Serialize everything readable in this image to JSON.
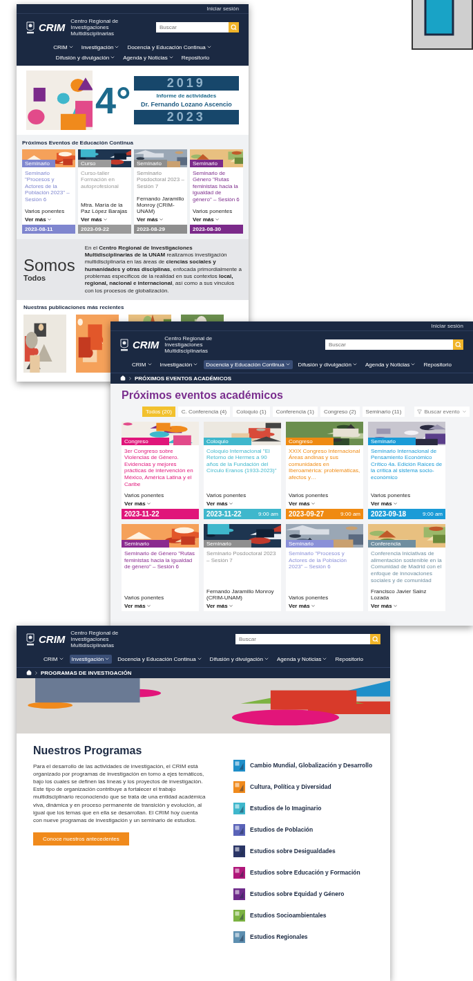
{
  "screens": [
    {
      "kind": "home",
      "header": {
        "login": "Iniciar sesión",
        "logo": "CRIM",
        "center_name": "Centro Regional de Investigaciones Multidisciplinarias",
        "search_placeholder": "Buscar",
        "nav": [
          {
            "label": "CRIM",
            "dropdown": true,
            "selected": false
          },
          {
            "label": "Investigación",
            "dropdown": true,
            "selected": false
          },
          {
            "label": "Docencia y Educación Continua",
            "dropdown": true,
            "selected": false
          },
          {
            "label": "Difusión y divulgación",
            "dropdown": true,
            "selected": false
          },
          {
            "label": "Agenda y Noticias",
            "dropdown": true,
            "selected": false
          },
          {
            "label": "Repositorio",
            "dropdown": false,
            "selected": false
          }
        ]
      },
      "hero": {
        "number": "4°",
        "year_start": "2019",
        "heading": "Informe de actividades",
        "name": "Dr. Fernando Lozano Ascencio",
        "year_end": "2023"
      },
      "events": {
        "title": "Próximos Eventos de Educación Continua",
        "cards": [
          {
            "tag": "Seminario",
            "title": "Seminario \"Procesos y Actores de la Población 2023\" – Sesión 6",
            "author": "Varios ponentes",
            "more": "Ver más",
            "date": "2023-08-11",
            "color": "#7f86cf"
          },
          {
            "tag": "Curso",
            "title": "Curso-taller Formación en autoprofesional",
            "author": "Mtra. María de la Paz López Barajas",
            "more": "Ver más",
            "date": "2023-09-22",
            "color": "#9a9a9a"
          },
          {
            "tag": "Seminario",
            "title": "Seminario Posdoctoral 2023 – Sesión 7",
            "author": "Fernando Jaramillo Monroy (CRIM-UNAM)",
            "more": "Ver más",
            "date": "2023-08-29",
            "color": "#8e8e8e"
          },
          {
            "tag": "Seminario",
            "title": "Seminario de Género \"Rutas feministas hacia la igualdad de género\" – Sesión 6",
            "author": "Varios ponentes",
            "more": "Ver más",
            "date": "2023-08-30",
            "color": "#7b2a8a"
          }
        ]
      },
      "about": {
        "title": "Somos",
        "subtitle": "Todos",
        "text": "En el **Centro Regional de Investigaciones Multidisciplinarias de la UNAM** realizamos investigación multidisciplinaria en las áreas de **ciencias sociales y humanidades y otras disciplinas**, enfocada primordialmente a problemas específicos de la realidad en sus contextos **local, regional, nacional e internacional**, así como a sus vínculos con los procesos de globalización."
      },
      "publications": {
        "title": "Nuestras publicaciones más recientes"
      }
    },
    {
      "kind": "events",
      "header": {
        "login": "Iniciar sesión",
        "logo": "CRIM",
        "center_name": "Centro Regional de Investigaciones Multidisciplinarias",
        "search_placeholder": "Buscar",
        "nav": [
          {
            "label": "CRIM",
            "dropdown": true,
            "selected": false
          },
          {
            "label": "Investigación",
            "dropdown": true,
            "selected": false
          },
          {
            "label": "Docencia y Educación Continua",
            "dropdown": true,
            "selected": true
          },
          {
            "label": "Difusión y divulgación",
            "dropdown": true,
            "selected": false
          },
          {
            "label": "Agenda y Noticias",
            "dropdown": true,
            "selected": false
          },
          {
            "label": "Repositorio",
            "dropdown": false,
            "selected": false
          }
        ],
        "breadcrumb": "PRÓXIMOS EVENTOS ACADÉMICOS"
      },
      "title": "Próximos eventos académicos",
      "filters": [
        {
          "label": "Todos (20)",
          "selected": true
        },
        {
          "label": "C. Conferencia (4)",
          "selected": false
        },
        {
          "label": "Coloquio (1)",
          "selected": false
        },
        {
          "label": "Conferencia (1)",
          "selected": false
        },
        {
          "label": "Congreso (2)",
          "selected": false
        },
        {
          "label": "Seminario (11)",
          "selected": false
        }
      ],
      "event_search": {
        "placeholder": "Buscar evento"
      },
      "cards": [
        {
          "tag": "Congreso",
          "title": "3er Congreso sobre Violencias de Género. Evidencias y mejores prácticas de intervención en México, América Latina y el Caribe",
          "author": "Varios ponentes",
          "more": "Ver más",
          "date": "2023-11-22",
          "color": "#e0157a"
        },
        {
          "tag": "Coloquio",
          "title": "Coloquio Internacional \"El Retorno de Hermes a 90 años de la Fundación del Círculo Eranos (1933-2023)\"",
          "author": "Varios ponentes",
          "more": "Ver más",
          "date": "2023-11-22",
          "time": "9:00 am",
          "color": "#3fb7cc"
        },
        {
          "tag": "Congreso",
          "title": "XXIX Congreso Internacional Áreas andinas y sus comunidades en Iberoamérica: problemáticas, afectos y…",
          "author": "Varios ponentes",
          "more": "Ver más",
          "date": "2023-09-27",
          "time": "9:00 am",
          "color": "#ef8a12"
        },
        {
          "tag": "Seminario",
          "title": "Seminario Internacional de Pensamiento Económico Crítico 4a. Edición Raíces de la crítica al sistema socio-económico",
          "author": "Varios ponentes",
          "more": "Ver más",
          "date": "2023-09-18",
          "time": "9:00 am",
          "color": "#1a9bd7"
        },
        {
          "tag": "Seminario",
          "title": "Seminario de Género \"Rutas feministas hacia la igualdad de género\" – Sesión 6",
          "author": "Varios ponentes",
          "more": "Ver más",
          "color": "#8a2a8f"
        },
        {
          "tag": "Seminario",
          "title": "Seminario Posdoctoral 2023 – Sesión 7",
          "author": "Fernando Jaramillo Monroy (CRIM-UNAM)",
          "more": "Ver más",
          "color": "#8f8f8f"
        },
        {
          "tag": "Seminario",
          "title": "Seminario \"Procesos y Actores de la Población 2023\" – Sesión 6",
          "author": "Varios ponentes",
          "more": "Ver más",
          "color": "#8a90d8"
        },
        {
          "tag": "Conferencia",
          "title": "Conferencia Iniciativas de alimentación sostenible en la Comunidad de Madrid con el enfoque de innovaciones sociales y de comunidad",
          "author": "Francisco Javier Sainz Lozada",
          "more": "Ver más",
          "color": "#6f8ea0"
        }
      ]
    },
    {
      "kind": "programs",
      "header": {
        "logo": "CRIM",
        "center_name": "Centro Regional de Investigaciones Multidisciplinarias",
        "search_placeholder": "Buscar",
        "nav": [
          {
            "label": "CRIM",
            "dropdown": true,
            "selected": false
          },
          {
            "label": "Investigación",
            "dropdown": true,
            "selected": true
          },
          {
            "label": "Docencia y Educación Continua",
            "dropdown": true,
            "selected": false
          },
          {
            "label": "Difusión y divulgación",
            "dropdown": true,
            "selected": false
          },
          {
            "label": "Agenda y Noticias",
            "dropdown": true,
            "selected": false
          },
          {
            "label": "Repositorio",
            "dropdown": false,
            "selected": false
          }
        ],
        "breadcrumb": "PROGRAMAS DE INVESTIGACIÓN"
      },
      "title": "Nuestros Programas",
      "text": "Para el desarrollo de las actividades de investigación, el CRIM está organizado por programas de investigación en torno a ejes temáticos, bajo los cuales se definen las líneas y los proyectos de investigación. Este tipo de organización contribuye a fortalecer el trabajo multidisciplinario reconociendo que se trata de una entidad académica viva, dinámica y en proceso permanente de transición y evolución, al igual que los temas que en ella se desarrollan. El CRIM hoy cuenta con nueve programas de investigación y un seminario de estudios.",
      "button": "Conoce nuestros antecedentes",
      "programs": [
        {
          "label": "Cambio Mundial, Globalización y Desarrollo",
          "color": "#1f8fc9"
        },
        {
          "label": "Cultura, Política y Diversidad",
          "color": "#f08a1c"
        },
        {
          "label": "Estudios de lo Imaginario",
          "color": "#3fb7cc"
        },
        {
          "label": "Estudios de Población",
          "color": "#5a63b8"
        },
        {
          "label": "Estudios sobre Desigualdades",
          "color": "#2a3566"
        },
        {
          "label": "Estudios sobre Educación y Formación",
          "color": "#b0177a"
        },
        {
          "label": "Estudios sobre Equidad y Género",
          "color": "#6e2a8a"
        },
        {
          "label": "Estudios Socioambientales",
          "color": "#7cb342"
        },
        {
          "label": "Estudios Regionales",
          "color": "#5d8fb0"
        }
      ]
    }
  ]
}
